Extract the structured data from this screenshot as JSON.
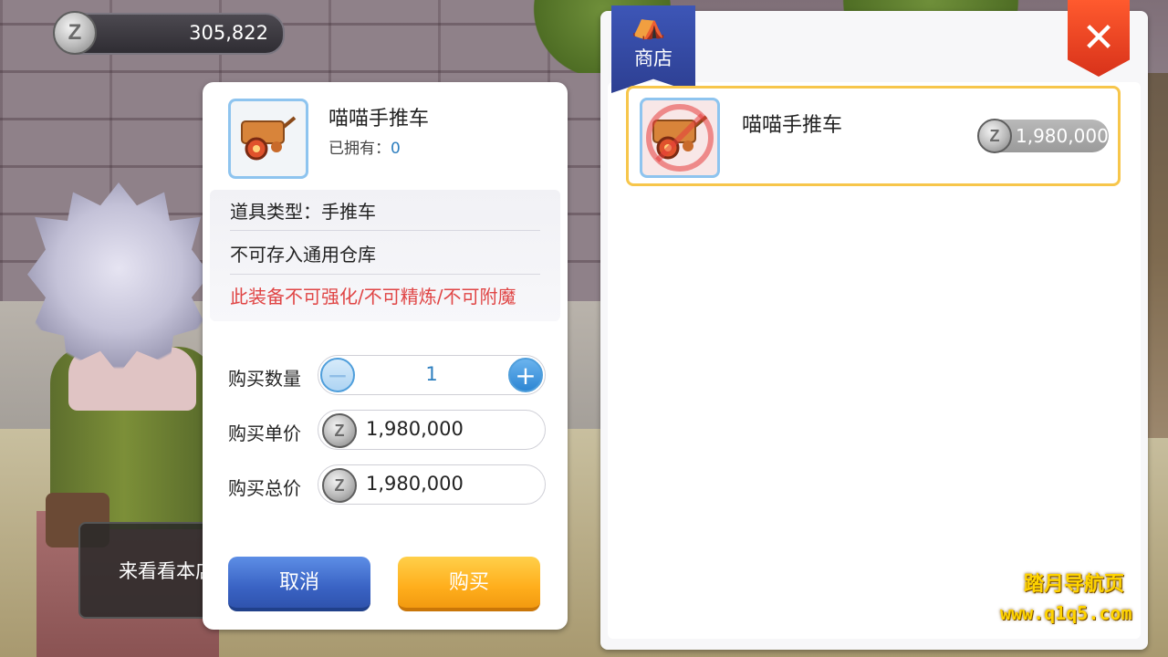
{
  "currency": {
    "value": "305,822",
    "icon": "z-coin-icon"
  },
  "chat": {
    "text": "来看看本店"
  },
  "dialog": {
    "item_name": "喵喵手推车",
    "owned_label": "已拥有：",
    "owned_count": "0",
    "info": {
      "type_line": "道具类型：手推车",
      "storage_line": "不可存入通用仓库",
      "restriction_line": "此装备不可强化/不可精炼/不可附魔"
    },
    "quantity": {
      "label": "购买数量",
      "value": "1"
    },
    "unit_price": {
      "label": "购买单价",
      "value": "1,980,000"
    },
    "total_price": {
      "label": "购买总价",
      "value": "1,980,000"
    },
    "cancel_label": "取消",
    "buy_label": "购买"
  },
  "shop": {
    "banner_label": "商店",
    "close_label": "✕",
    "items": [
      {
        "name": "喵喵手推车",
        "price": "1,980,000"
      }
    ]
  },
  "watermark": {
    "line1": "踏月导航页",
    "line2": "www.q1q5.com"
  },
  "colors": {
    "accent_blue": "#2e7fbf",
    "warning_red": "#e04545",
    "buy_orange": "#ffae1c",
    "cancel_blue": "#3a63c4",
    "selected_border": "#f7c64b"
  }
}
